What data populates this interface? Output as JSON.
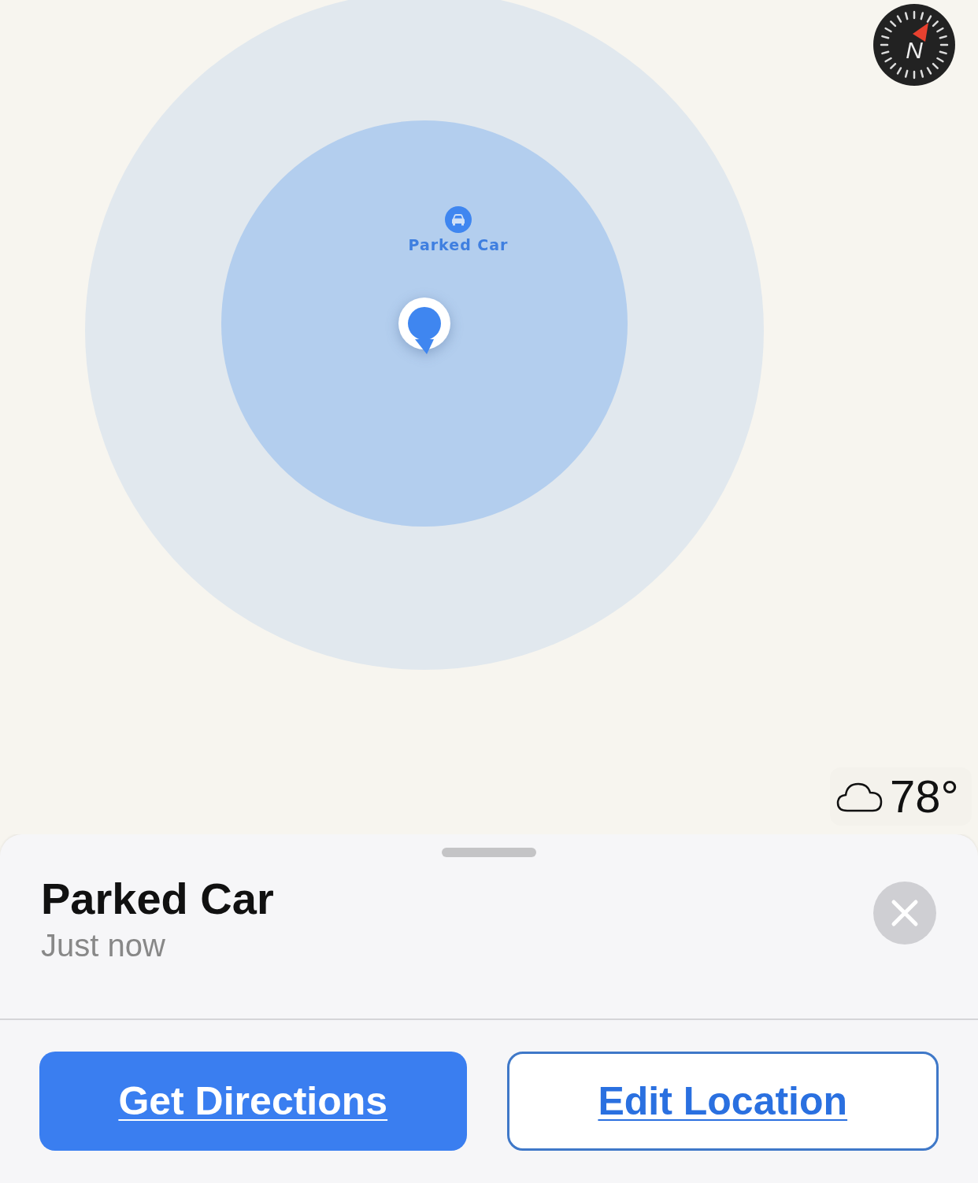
{
  "map": {
    "pin_label": "Parked Car",
    "compass": {
      "label": "N"
    },
    "weather": {
      "temperature": "78°"
    }
  },
  "sheet": {
    "title": "Parked Car",
    "subtitle": "Just now",
    "buttons": [
      {
        "label": "Get Directions",
        "kind": "primary"
      },
      {
        "label": "Edit Location",
        "kind": "outline"
      }
    ]
  }
}
